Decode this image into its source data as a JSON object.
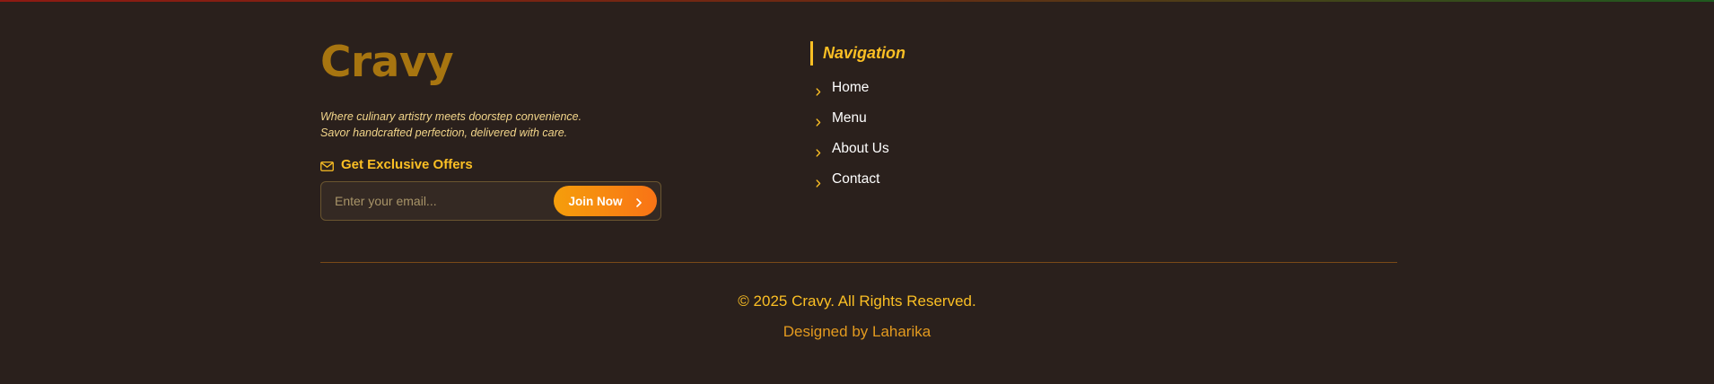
{
  "brand": {
    "name": "Cravy",
    "tagline_line1": "Where culinary artistry meets doorstep convenience.",
    "tagline_line2": "Savor handcrafted perfection, delivered with care."
  },
  "newsletter": {
    "title": "Get Exclusive Offers",
    "icon": "mail-icon",
    "email_value": "",
    "email_placeholder": "Enter your email...",
    "button_label": "Join Now",
    "button_icon": "chevron-right-icon"
  },
  "navigation": {
    "title": "Navigation",
    "items": [
      {
        "label": "Home"
      },
      {
        "label": "Menu"
      },
      {
        "label": "About Us"
      },
      {
        "label": "Contact"
      }
    ]
  },
  "footer_bottom": {
    "copyright": "© 2025 Cravy. All Rights Reserved.",
    "credit": "Designed by Laharika"
  },
  "colors": {
    "background": "#2a201c",
    "brand": "#a77510",
    "accent": "#fbbf24",
    "button_start": "#f59e0b",
    "button_end": "#f97316",
    "divider": "#7a4a18"
  }
}
